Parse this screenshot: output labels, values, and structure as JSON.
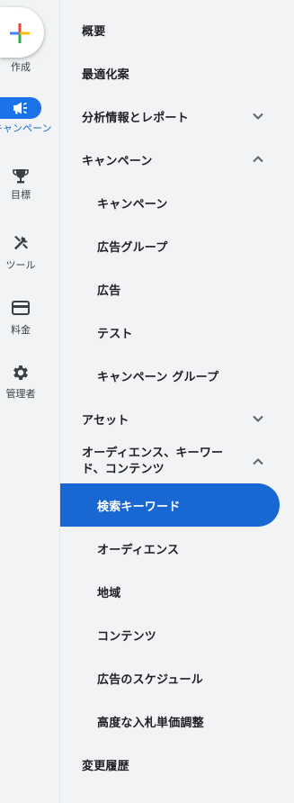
{
  "rail": {
    "create_label": "作成",
    "campaigns_label": "キャンペーン",
    "goals_label": "目標",
    "tools_label": "ツール",
    "billing_label": "料金",
    "admin_label": "管理者"
  },
  "menu": {
    "overview": "概要",
    "recommendations": "最適化案",
    "insights": "分析情報とレポート",
    "campaigns": "キャンペーン",
    "campaigns_sub": "キャンペーン",
    "ad_groups": "広告グループ",
    "ads": "広告",
    "experiments": "テスト",
    "campaign_groups": "キャンペーン グループ",
    "assets": "アセット",
    "audiences_header": "オーディエンス、キーワード、コンテンツ",
    "search_keywords": "検索キーワード",
    "audiences": "オーディエンス",
    "locations": "地域",
    "content": "コンテンツ",
    "ad_schedule": "広告のスケジュール",
    "advanced_bid": "高度な入札単価調整",
    "change_history": "変更履歴"
  },
  "colors": {
    "accent": "#1967d2",
    "rail_bg": "#f1f3f4",
    "text": "#202124"
  }
}
